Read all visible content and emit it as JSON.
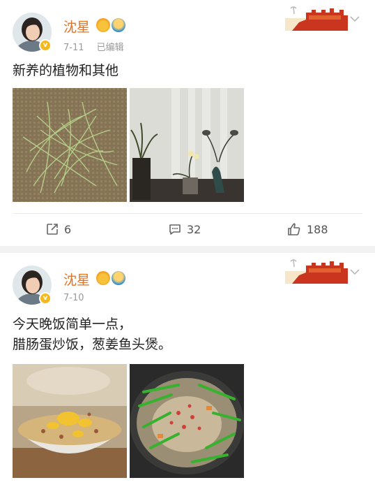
{
  "posts": [
    {
      "user": {
        "name": "沈星",
        "avatar": "avatar",
        "verified_icon": "v-badge-icon"
      },
      "meta": {
        "date": "7-11",
        "edited": "已编辑"
      },
      "text_lines": [
        "新养的植物和其他"
      ],
      "images": [
        "sprouts-photo",
        "houseplants-photo"
      ],
      "actions": {
        "repost": "6",
        "comment": "32",
        "like": "188"
      }
    },
    {
      "user": {
        "name": "沈星",
        "avatar": "avatar",
        "verified_icon": "v-badge-icon"
      },
      "meta": {
        "date": "7-10"
      },
      "text_lines": [
        "今天晚饭简单一点，",
        "腊肠蛋炒饭，葱姜鱼头煲。"
      ],
      "images": [
        "fried-rice-photo",
        "fish-head-pot-photo"
      ]
    }
  ],
  "colors": {
    "name": "#e8721c",
    "meta": "#9a9a9a",
    "separator": "#f2f2f2"
  }
}
